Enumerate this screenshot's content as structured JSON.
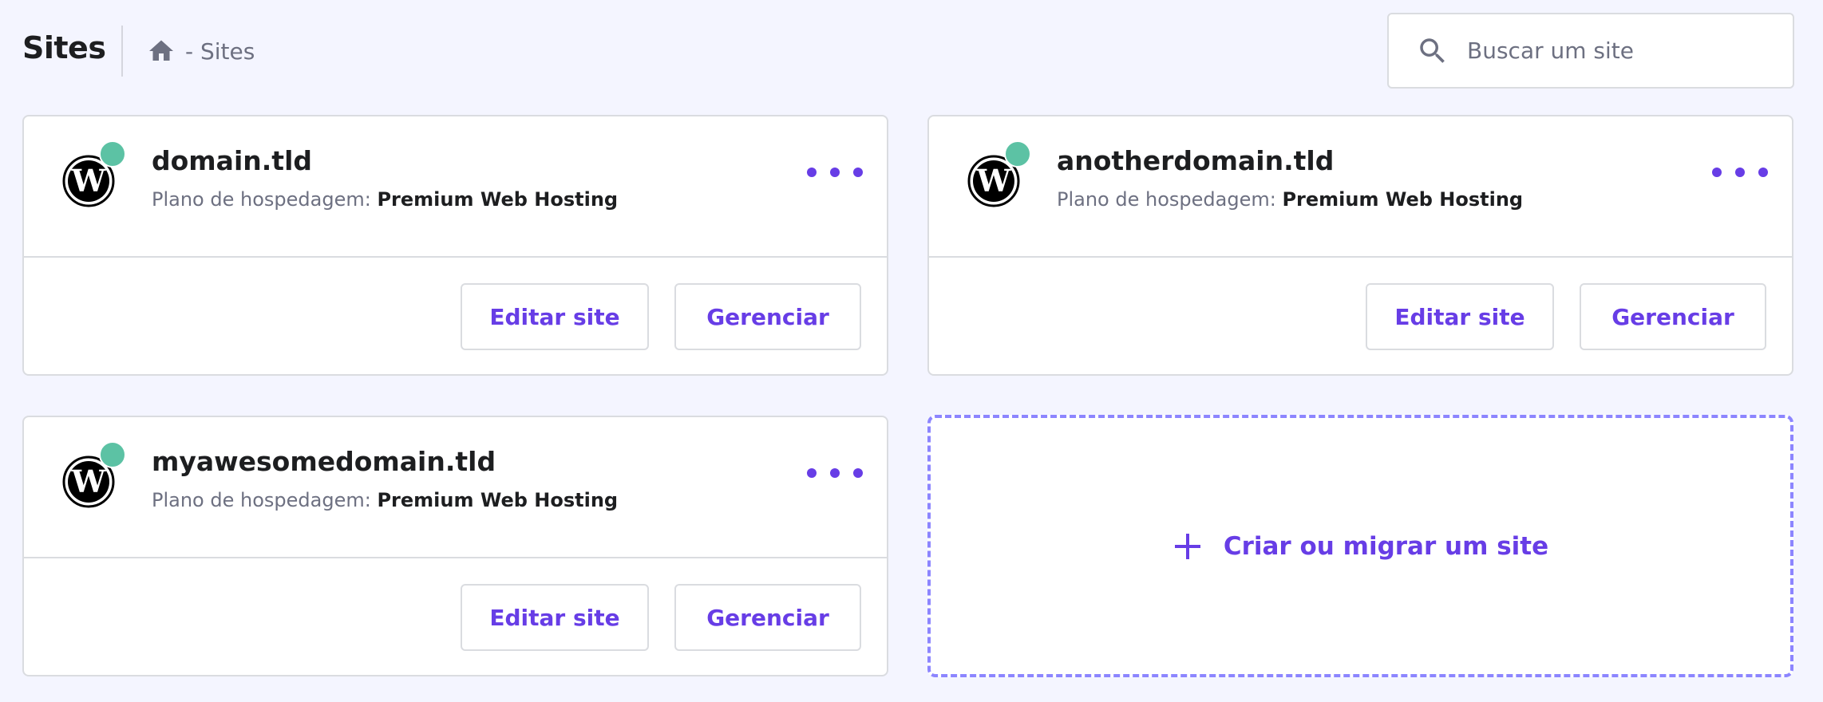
{
  "header": {
    "title": "Sites",
    "breadcrumb": {
      "home_icon": "home-icon",
      "current": "- Sites"
    },
    "search": {
      "placeholder": "Buscar um site",
      "value": "",
      "icon": "search-icon"
    }
  },
  "colors": {
    "accent": "#673de6",
    "status_online": "#5cc2a4",
    "background": "#f4f5ff",
    "dashed_border": "#8c85ff"
  },
  "sites": [
    {
      "domain": "domain.tld",
      "plan_label": "Plano de hospedagem:",
      "plan": "Premium Web Hosting",
      "status": "online",
      "edit_label": "Editar site",
      "manage_label": "Gerenciar"
    },
    {
      "domain": "anotherdomain.tld",
      "plan_label": "Plano de hospedagem:",
      "plan": "Premium Web Hosting",
      "status": "online",
      "edit_label": "Editar site",
      "manage_label": "Gerenciar"
    },
    {
      "domain": "myawesomedomain.tld",
      "plan_label": "Plano de hospedagem:",
      "plan": "Premium Web Hosting",
      "status": "online",
      "edit_label": "Editar site",
      "manage_label": "Gerenciar"
    }
  ],
  "create": {
    "label": "Criar ou migrar um site",
    "icon": "plus-icon"
  }
}
